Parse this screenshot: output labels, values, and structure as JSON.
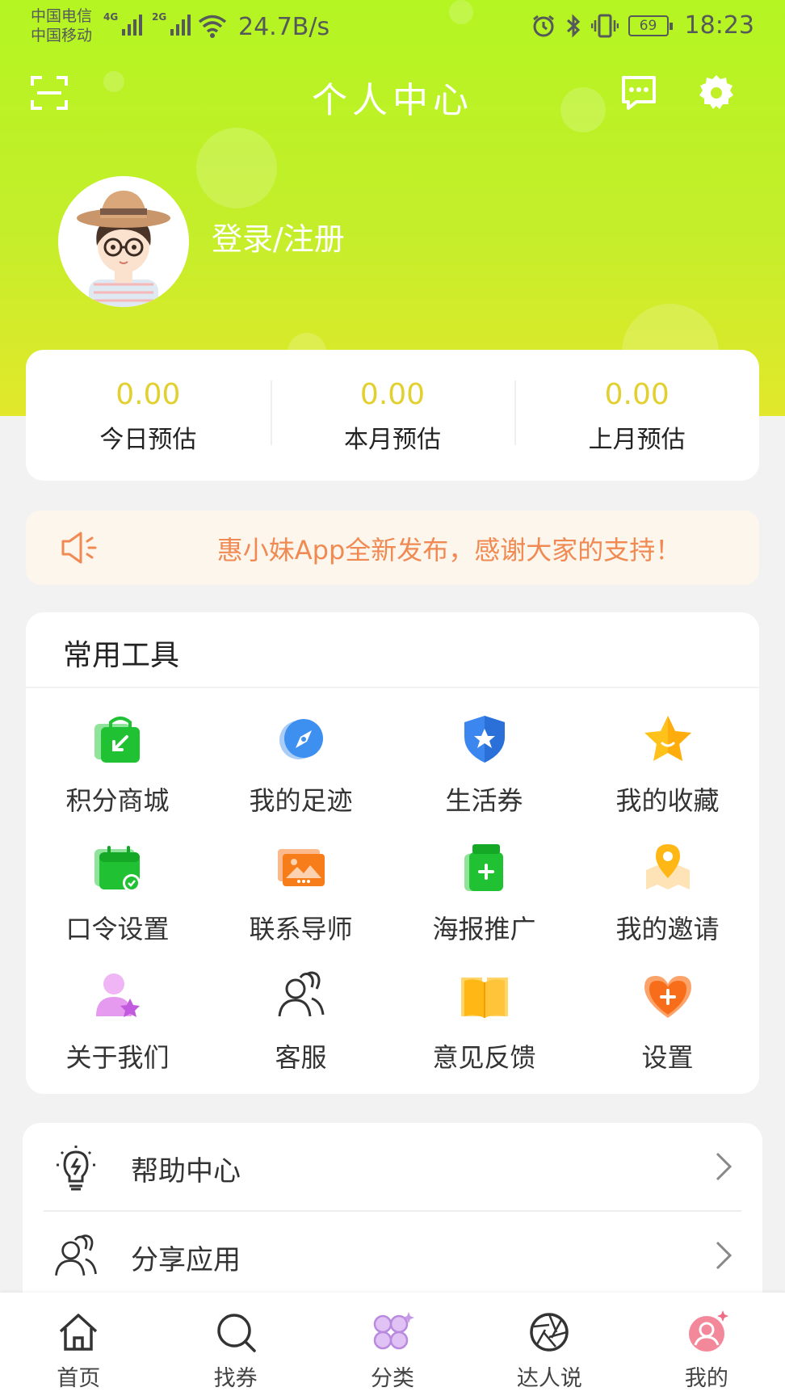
{
  "status_bar": {
    "carrier_1": "中国电信",
    "carrier_2": "中国移动",
    "net_1": "4G",
    "net_2": "2G",
    "speed": "24.7B/s",
    "battery": "69",
    "time": "18:23"
  },
  "header": {
    "title": "个人中心"
  },
  "profile": {
    "login_label": "登录/注册"
  },
  "stats": [
    {
      "value": "0.00",
      "label": "今日预估"
    },
    {
      "value": "0.00",
      "label": "本月预估"
    },
    {
      "value": "0.00",
      "label": "上月预估"
    }
  ],
  "notice": {
    "text": "惠小妹App全新发布，感谢大家的支持！"
  },
  "tools": {
    "title": "常用工具",
    "items": [
      {
        "label": "积分商城",
        "icon": "shopping-bag-icon"
      },
      {
        "label": "我的足迹",
        "icon": "compass-icon"
      },
      {
        "label": "生活券",
        "icon": "shield-star-icon"
      },
      {
        "label": "我的收藏",
        "icon": "star-icon"
      },
      {
        "label": "口令设置",
        "icon": "calendar-check-icon"
      },
      {
        "label": "联系导师",
        "icon": "picture-icon"
      },
      {
        "label": "海报推广",
        "icon": "jar-plus-icon"
      },
      {
        "label": "我的邀请",
        "icon": "map-pin-icon"
      },
      {
        "label": "关于我们",
        "icon": "user-star-icon"
      },
      {
        "label": "客服",
        "icon": "users-icon"
      },
      {
        "label": "意见反馈",
        "icon": "book-icon"
      },
      {
        "label": "设置",
        "icon": "heart-plus-icon"
      }
    ]
  },
  "list": [
    {
      "label": "帮助中心",
      "icon": "lightbulb-icon"
    },
    {
      "label": "分享应用",
      "icon": "users-icon"
    }
  ],
  "tabbar": [
    {
      "label": "首页",
      "icon": "home-icon"
    },
    {
      "label": "找券",
      "icon": "search-icon"
    },
    {
      "label": "分类",
      "icon": "category-icon"
    },
    {
      "label": "达人说",
      "icon": "aperture-icon"
    },
    {
      "label": "我的",
      "icon": "profile-icon",
      "active": true
    }
  ],
  "colors": {
    "header_top": "#b4f522",
    "header_bottom": "#e2e82b",
    "stat_value": "#e1d02f",
    "notice_text": "#f08a52",
    "notice_bg": "#fcf6ec"
  }
}
